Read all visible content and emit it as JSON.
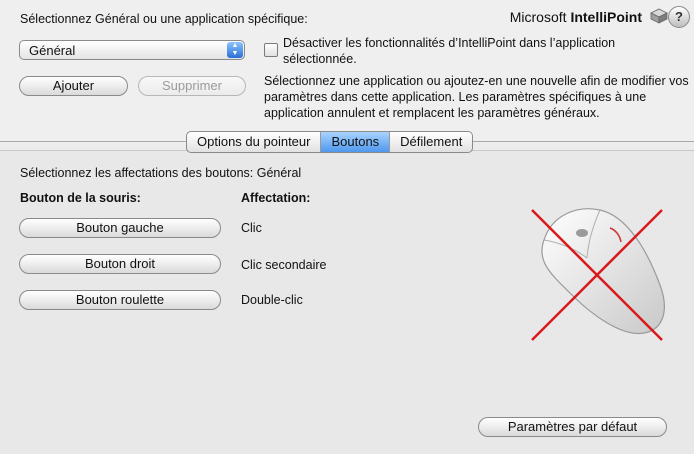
{
  "header": {
    "select_label": "Sélectionnez Général ou une application spécifique:",
    "brand_prefix": "Microsoft ",
    "brand_name": "IntelliPoint",
    "help_label": "?"
  },
  "app_select": {
    "value": "Général"
  },
  "disable_checkbox": {
    "checked": false,
    "label": "Désactiver les fonctionnalités d’IntelliPoint dans l’application sélectionnée."
  },
  "buttons": {
    "add": "Ajouter",
    "remove": "Supprimer",
    "defaults": "Paramètres par défaut"
  },
  "info_text": "Sélectionnez une application ou ajoutez-en une nouvelle afin de modifier vos paramètres dans cette application. Les paramètres spécifiques à une application annulent et remplacent les paramètres généraux.",
  "tabs": [
    {
      "label": "Options du pointeur",
      "active": false
    },
    {
      "label": "Boutons",
      "active": true
    },
    {
      "label": "Défilement",
      "active": false
    }
  ],
  "panel": {
    "title": "Sélectionnez les affectations des boutons: Général",
    "col_button": "Bouton de la souris:",
    "col_assignment": "Affectation:",
    "rows": [
      {
        "button": "Bouton gauche",
        "assignment": "Clic"
      },
      {
        "button": "Bouton droit",
        "assignment": "Clic secondaire"
      },
      {
        "button": "Bouton roulette",
        "assignment": "Double-clic"
      }
    ]
  },
  "colors": {
    "accent": "#4f98ee",
    "cross": "#d9191c"
  }
}
